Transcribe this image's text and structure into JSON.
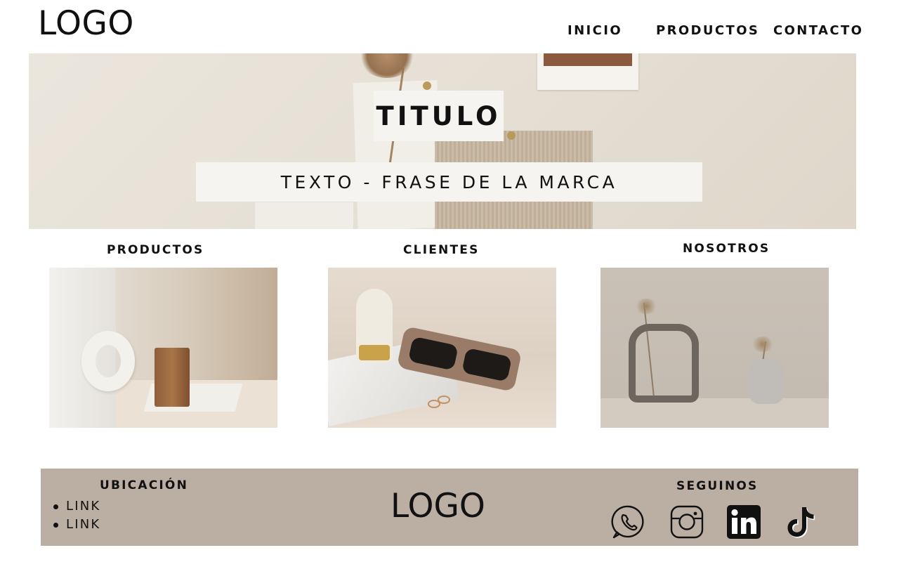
{
  "header": {
    "logo": "LOGO",
    "nav": [
      "INICIO",
      "PRODUCTOS",
      "CONTACTO"
    ]
  },
  "hero": {
    "title": "TITULO",
    "phrase": "TEXTO - FRASE DE LA MARCA"
  },
  "sections": [
    {
      "heading": "PRODUCTOS"
    },
    {
      "heading": "CLIENTES"
    },
    {
      "heading": "NOSOTROS"
    }
  ],
  "footer": {
    "location_heading": "UBICACIÓN",
    "links": [
      "LINK",
      "LINK"
    ],
    "logo": "LOGO",
    "social_heading": "SEGUINOS",
    "social_icons": [
      "whatsapp-icon",
      "instagram-icon",
      "linkedin-icon",
      "tiktok-icon"
    ]
  },
  "colors": {
    "footer_bg": "#bbafa4",
    "text": "#111111",
    "box_bg": "#f6f4f0"
  }
}
